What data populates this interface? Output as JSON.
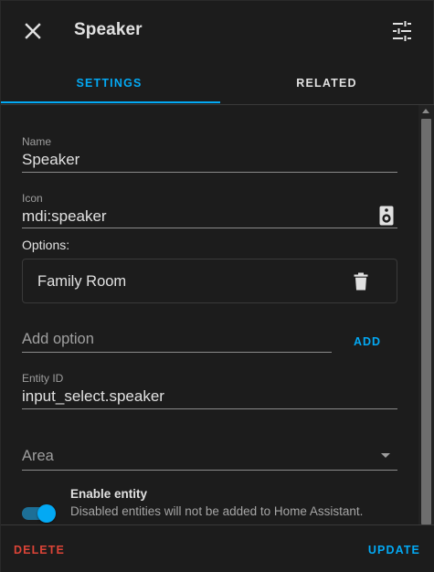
{
  "header": {
    "title": "Speaker",
    "close_icon": "close-icon",
    "settings_icon": "tune-icon"
  },
  "tabs": [
    {
      "label": "SETTINGS",
      "active": true
    },
    {
      "label": "RELATED",
      "active": false
    }
  ],
  "form": {
    "name": {
      "label": "Name",
      "value": "Speaker"
    },
    "icon": {
      "label": "Icon",
      "value": "mdi:speaker",
      "preview_icon": "speaker-icon"
    },
    "options_label": "Options:",
    "options": [
      {
        "label": "Family Room",
        "icon": "delete-icon"
      }
    ],
    "add_option": {
      "placeholder": "Add option",
      "value": "",
      "button_label": "ADD"
    },
    "entity_id": {
      "label": "Entity ID",
      "value": "input_select.speaker"
    },
    "area": {
      "label": "Area",
      "value": ""
    },
    "enable_entity": {
      "title": "Enable entity",
      "description": "Disabled entities will not be added to Home Assistant.",
      "enabled": true
    }
  },
  "footer": {
    "delete_label": "DELETE",
    "update_label": "UPDATE"
  },
  "colors": {
    "accent": "#03a9f4",
    "danger": "#db4437",
    "background": "#1c1c1c"
  }
}
